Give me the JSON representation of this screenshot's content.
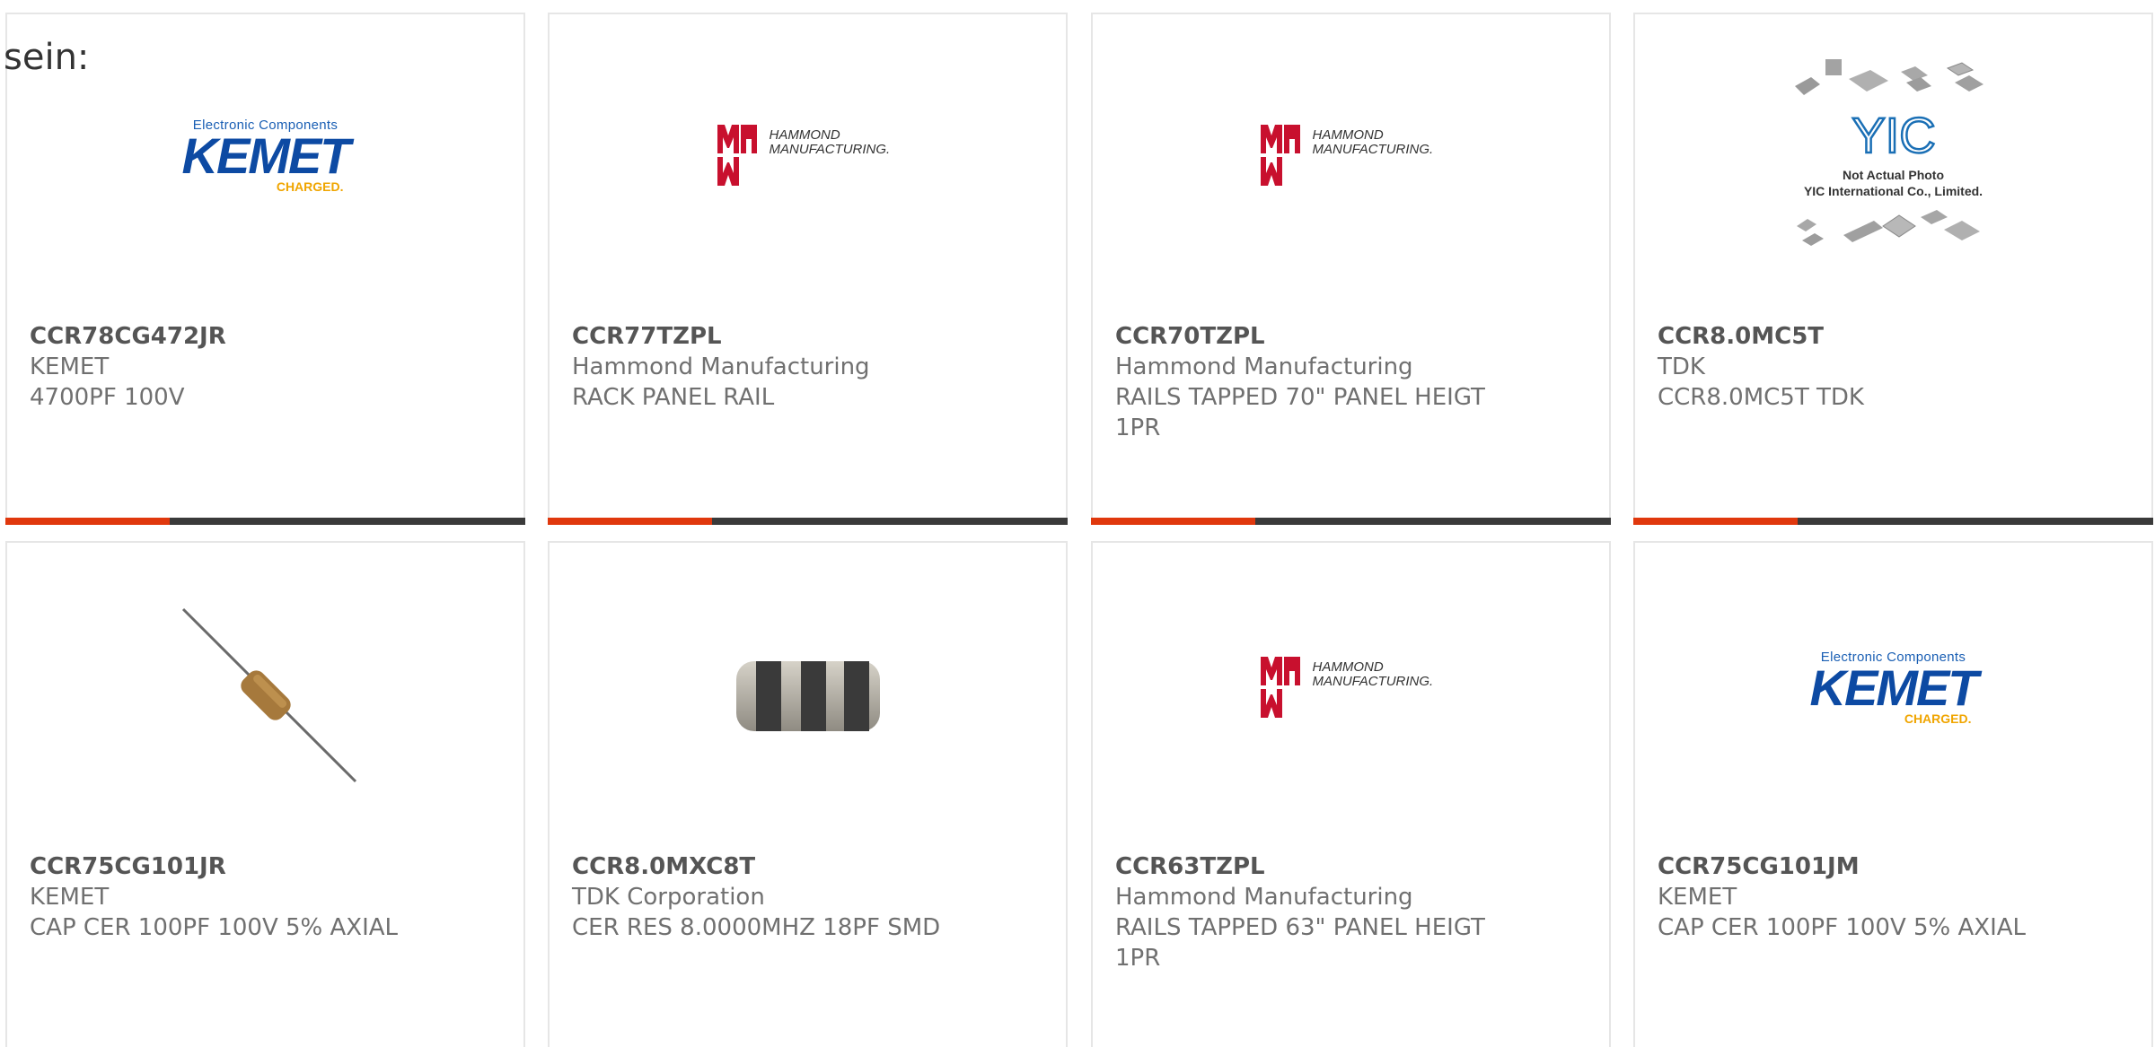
{
  "intro_text": "sein:",
  "accent_color": "#e0380d",
  "products": [
    {
      "part_number": "CCR78CG472JR",
      "manufacturer": "KEMET",
      "description": "4700PF 100V",
      "image": "kemet-logo",
      "logo_text": {
        "tagline": "Electronic Components",
        "brand": "KEMET",
        "charged": "CHARGED."
      }
    },
    {
      "part_number": "CCR77TZPL",
      "manufacturer": "Hammond Manufacturing",
      "description": "RACK PANEL RAIL",
      "image": "hammond-logo",
      "logo_text": {
        "line1": "HAMMOND",
        "line2": "MANUFACTURING."
      }
    },
    {
      "part_number": "CCR70TZPL",
      "manufacturer": "Hammond Manufacturing",
      "description": "RAILS TAPPED 70\" PANEL HEIGT 1PR",
      "image": "hammond-logo",
      "logo_text": {
        "line1": "HAMMOND",
        "line2": "MANUFACTURING."
      }
    },
    {
      "part_number": "CCR8.0MC5T",
      "manufacturer": "TDK",
      "description": "CCR8.0MC5T TDK",
      "image": "yic-placeholder-photo",
      "logo_text": {
        "brand": "YIC",
        "caption1": "Not Actual Photo",
        "caption2": "YIC International Co., Limited."
      }
    },
    {
      "part_number": "CCR75CG101JR",
      "manufacturer": "KEMET",
      "description": "CAP CER 100PF 100V 5% AXIAL",
      "image": "axial-capacitor-photo"
    },
    {
      "part_number": "CCR8.0MXC8T",
      "manufacturer": "TDK Corporation",
      "description": "CER RES 8.0000MHZ 18PF SMD",
      "image": "smd-resonator-photo"
    },
    {
      "part_number": "CCR63TZPL",
      "manufacturer": "Hammond Manufacturing",
      "description": "RAILS TAPPED 63\" PANEL HEIGT 1PR",
      "image": "hammond-logo",
      "logo_text": {
        "line1": "HAMMOND",
        "line2": "MANUFACTURING."
      }
    },
    {
      "part_number": "CCR75CG101JM",
      "manufacturer": "KEMET",
      "description": "CAP CER 100PF 100V 5% AXIAL",
      "image": "kemet-logo",
      "logo_text": {
        "tagline": "Electronic Components",
        "brand": "KEMET",
        "charged": "CHARGED."
      }
    }
  ]
}
